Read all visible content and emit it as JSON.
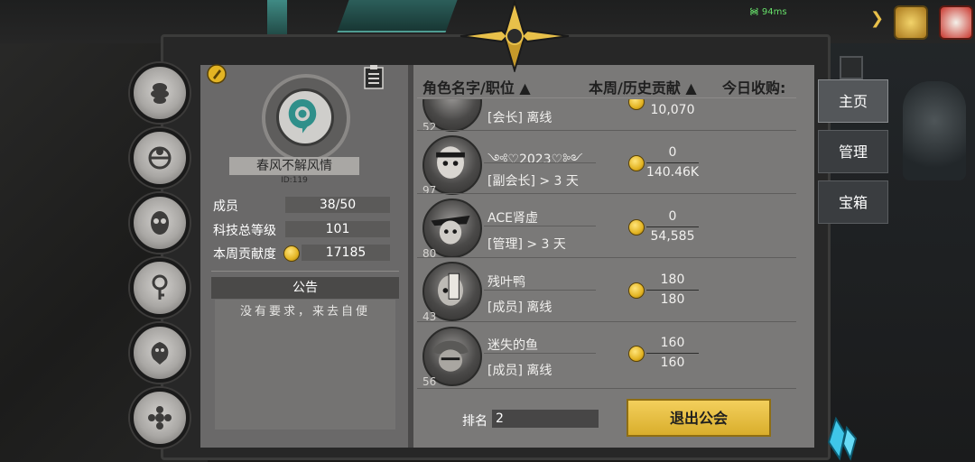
{
  "status": {
    "ping": "94ms"
  },
  "guild": {
    "name": "春风不解风情",
    "id_text": "ID:119",
    "stats": [
      {
        "label": "成员",
        "value": "38/50"
      },
      {
        "label": "科技总等级",
        "value": "101"
      },
      {
        "label": "本周贡献度",
        "value": "17185"
      }
    ],
    "notice_title": "公告",
    "notice_text": "没有要求，来去自便"
  },
  "table": {
    "col_name": "角色名字/职位 ▲",
    "col_contrib": "本周/历史贡献 ▲",
    "col_today": "今日收购:"
  },
  "members": [
    {
      "level": "52",
      "name": "",
      "role": "[会长] 离线",
      "week": "",
      "total": "10,070"
    },
    {
      "level": "97",
      "name": "༺♡2023♡༻",
      "role": "[副会长] > 3 天",
      "week": "0",
      "total": "140.46K"
    },
    {
      "level": "80",
      "name": "ACE肾虚",
      "role": "[管理] > 3 天",
      "week": "0",
      "total": "54,585"
    },
    {
      "level": "43",
      "name": "残叶鸭",
      "role": "[成员] 离线",
      "week": "180",
      "total": "180"
    },
    {
      "level": "56",
      "name": "迷失的鱼",
      "role": "[成员] 离线",
      "week": "160",
      "total": "160"
    }
  ],
  "footer": {
    "rank_label": "排名",
    "rank_value": "2",
    "exit_label": "退出公会"
  },
  "tabs": [
    {
      "label": "主页",
      "active": true
    },
    {
      "label": "管理",
      "active": false
    },
    {
      "label": "宝箱",
      "active": false
    }
  ],
  "colors": {
    "accent_gold": "#e8c04a",
    "panel": "#7a7978"
  }
}
